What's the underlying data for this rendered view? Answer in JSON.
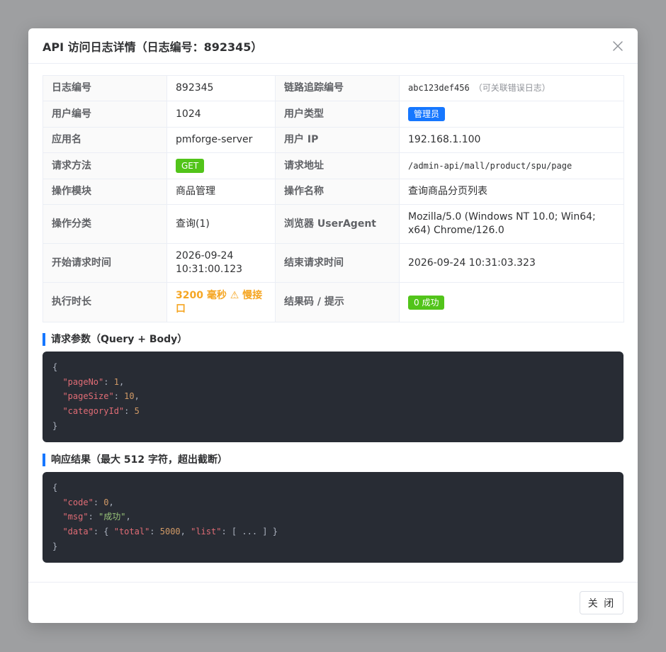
{
  "modal": {
    "title": "API 访问日志详情（日志编号：892345）",
    "close_icon": "close-icon",
    "footer_button": "关 闭"
  },
  "details": {
    "rows": [
      {
        "l1": "日志编号",
        "v1": "892345",
        "l2": "链路追踪编号",
        "v2": "abc123def456",
        "v2_hint": "（可关联错误日志）"
      },
      {
        "l1": "用户编号",
        "v1": "1024",
        "l2": "用户类型",
        "v2": "管理员"
      },
      {
        "l1": "应用名",
        "v1": "pmforge-server",
        "l2": "用户 IP",
        "v2": "192.168.1.100"
      },
      {
        "l1": "请求方法",
        "v1": "GET",
        "l2": "请求地址",
        "v2": "/admin-api/mall/product/spu/page"
      },
      {
        "l1": "操作模块",
        "v1": "商品管理",
        "l2": "操作名称",
        "v2": "查询商品分页列表"
      },
      {
        "l1": "操作分类",
        "v1": "查询(1)",
        "l2": "浏览器 UserAgent",
        "v2": "Mozilla/5.0 (Windows NT 10.0; Win64; x64) Chrome/126.0"
      },
      {
        "l1": "开始请求时间",
        "v1": "2026-09-24 10:31:00.123",
        "l2": "结束请求时间",
        "v2": "2026-09-24 10:31:03.323"
      },
      {
        "l1": "执行时长",
        "v1": "3200 毫秒 ⚠ 慢接口",
        "l2": "结果码 / 提示",
        "v2": "0 成功"
      }
    ]
  },
  "request": {
    "title": "请求参数（Query + Body）",
    "lines": [
      {
        "pre": "{"
      },
      {
        "key": "\"pageNo\"",
        "sep": ": ",
        "val": "1",
        "post": ","
      },
      {
        "key": "\"pageSize\"",
        "sep": ": ",
        "val": "10",
        "post": ","
      },
      {
        "key": "\"categoryId\"",
        "sep": ": ",
        "val": "5",
        "post": ""
      },
      {
        "pre": "}"
      }
    ]
  },
  "response": {
    "title": "响应结果（最大 512 字符，超出截断）",
    "code_key": "\"code\"",
    "code_val": "0",
    "msg_key": "\"msg\"",
    "msg_val": "\"成功\"",
    "data_key": "\"data\"",
    "total_key": "\"total\"",
    "total_val": "5000",
    "list_key": "\"list\"",
    "list_val": "[ ... ]"
  },
  "colors": {
    "accent": "#1677ff",
    "success": "#52c41a",
    "warning": "#f5a623",
    "code_bg": "#282c34"
  }
}
